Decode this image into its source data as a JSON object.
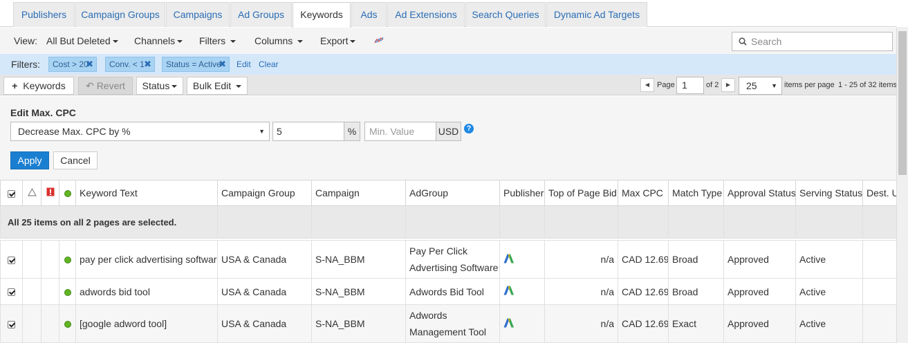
{
  "tabs": [
    {
      "label": "Publishers",
      "active": false
    },
    {
      "label": "Campaign Groups",
      "active": false
    },
    {
      "label": "Campaigns",
      "active": false
    },
    {
      "label": "Ad Groups",
      "active": false
    },
    {
      "label": "Keywords",
      "active": true
    },
    {
      "label": "Ads",
      "active": false
    },
    {
      "label": "Ad Extensions",
      "active": false
    },
    {
      "label": "Search Queries",
      "active": false
    },
    {
      "label": "Dynamic Ad Targets",
      "active": false
    }
  ],
  "toolbar": {
    "view_label": "View:",
    "view_value": "All But Deleted",
    "channels": "Channels",
    "filters": "Filters",
    "columns": "Columns",
    "export": "Export",
    "chart_icon": "trend-chart-icon",
    "search_placeholder": "Search"
  },
  "filters": {
    "label": "Filters:",
    "chips": [
      "Cost > 20",
      "Conv. < 1",
      "Status = Active"
    ],
    "edit": "Edit",
    "clear": "Clear"
  },
  "actions": {
    "add_keywords": "Keywords",
    "revert": "Revert",
    "status": "Status",
    "bulk_edit": "Bulk Edit"
  },
  "pager": {
    "page_label": "Page",
    "page_value": "1",
    "of_label": "of 2",
    "per_page_value": "25",
    "per_page_label": "items per page",
    "range": "1 - 25 of 32 items"
  },
  "edit_panel": {
    "title": "Edit Max. CPC",
    "operation": "Decrease Max. CPC by %",
    "amount": "5",
    "percent_unit": "%",
    "min_placeholder": "Min. Value",
    "currency": "USD",
    "help": "?",
    "apply": "Apply",
    "cancel": "Cancel"
  },
  "grid": {
    "headers": [
      "Keyword Text",
      "Campaign Group",
      "Campaign",
      "AdGroup",
      "Publisher",
      "Top of Page Bid",
      "Max CPC",
      "Match Type",
      "Approval Status",
      "Serving Status",
      "Dest. U"
    ],
    "selection_message": "All 25 items on all 2 pages are selected.",
    "rows": [
      {
        "keyword": "pay per click advertising software",
        "campaign_group": "USA & Canada",
        "campaign": "S-NA_BBM",
        "adgroup": "Pay Per Click Advertising Software",
        "top_bid": "n/a",
        "max_cpc": "CAD 12.69",
        "match": "Broad",
        "approval": "Approved",
        "serving": "Active"
      },
      {
        "keyword": "adwords bid tool",
        "campaign_group": "USA & Canada",
        "campaign": "S-NA_BBM",
        "adgroup": "Adwords Bid Tool",
        "top_bid": "n/a",
        "max_cpc": "CAD 12.69",
        "match": "Broad",
        "approval": "Approved",
        "serving": "Active"
      },
      {
        "keyword": "[google adword tool]",
        "campaign_group": "USA & Canada",
        "campaign": "S-NA_BBM",
        "adgroup": "Adwords Management Tool",
        "top_bid": "n/a",
        "max_cpc": "CAD 12.69",
        "match": "Exact",
        "approval": "Approved",
        "serving": "Active"
      }
    ]
  },
  "colors": {
    "link": "#2a6db5",
    "filter_bar": "#d4e8fa",
    "chip": "#a9d3f3",
    "primary_button": "#1b7fd1",
    "status_active": "#63b324"
  }
}
